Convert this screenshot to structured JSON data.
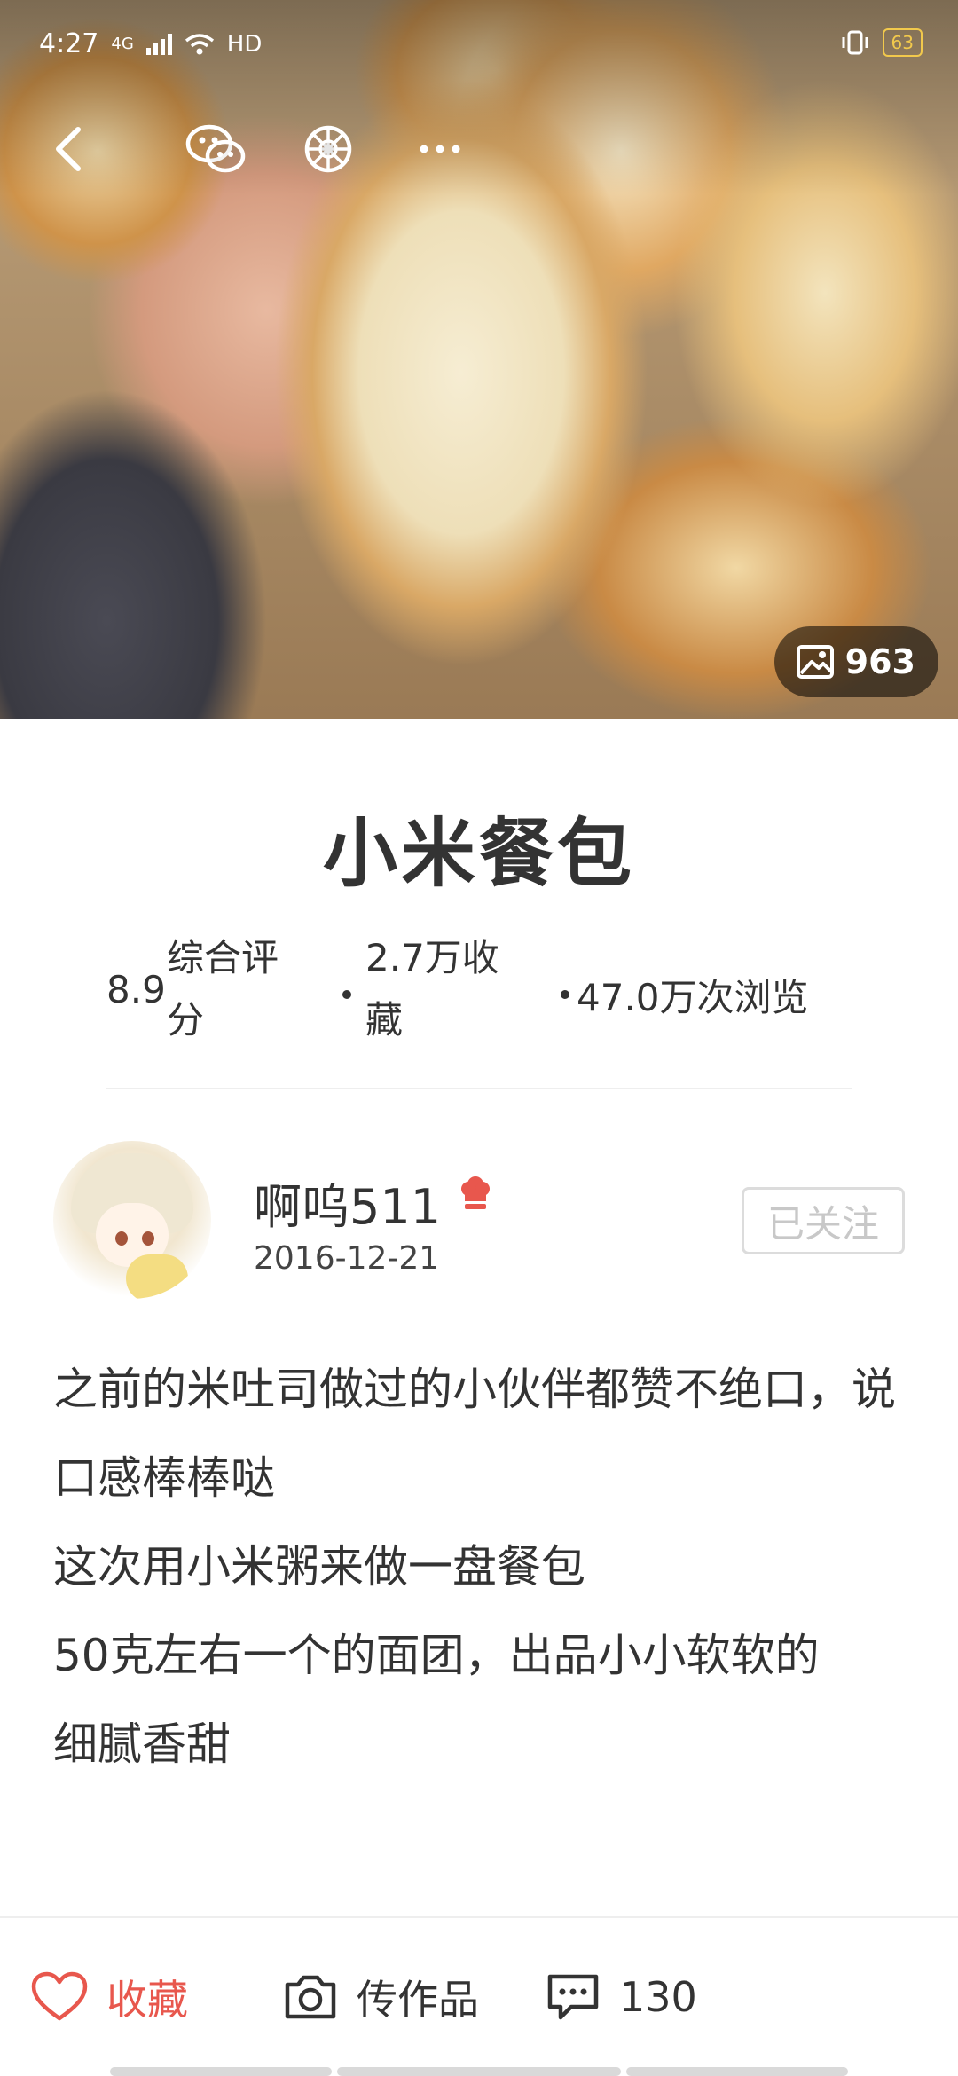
{
  "status_bar": {
    "time": "4:27",
    "network": "4G",
    "hd": "HD",
    "battery": "63"
  },
  "hero": {
    "photo_count": "963"
  },
  "recipe": {
    "title": "小米餐包",
    "score": "8.9",
    "score_label": "综合评分",
    "favorites": "2.7万收藏",
    "views": "47.0万次浏览"
  },
  "author": {
    "name": "啊呜511",
    "date": "2016-12-21",
    "follow_label": "已关注"
  },
  "description": {
    "lines": [
      "之前的米吐司做过的小伙伴都赞不绝口，说口感棒棒哒",
      "这次用小米粥来做一盘餐包",
      "50克左右一个的面团，出品小小软软的",
      "细腻香甜"
    ]
  },
  "bottom_bar": {
    "favorite_label": "收藏",
    "upload_label": "传作品",
    "comment_count": "130"
  },
  "colors": {
    "accent": "#e8574d",
    "text": "#333333",
    "follow_border": "#dcdcdc"
  }
}
